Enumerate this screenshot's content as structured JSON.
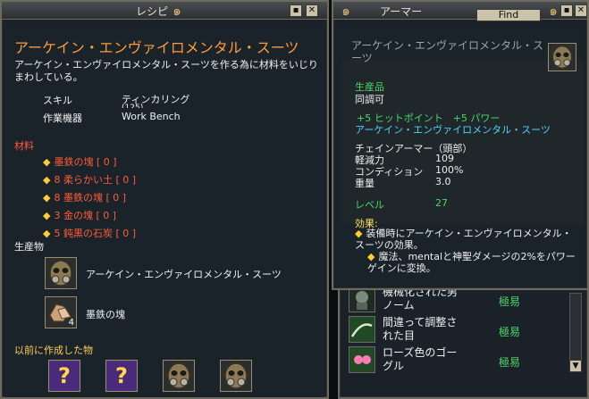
{
  "recipe_window": {
    "title": "レシピ",
    "item_title": "アーケイン・エンヴァイロメンタル・スーツ",
    "description": "アーケイン・エンヴァイロメンタル・スーツを作る為に材料をいじりまわしている。",
    "skill_label": "スキル",
    "skill_value": "ティンカリング",
    "skill_value_cut": "(125)",
    "station_label": "作業機器",
    "station_value": "Work Bench",
    "materials_label": "材料",
    "materials": [
      "墨鉄の塊 [ 0 ]",
      "8 柔らかい土 [ 0 ]",
      "8 墨鉄の塊 [ 0 ]",
      "3 金の塊 [ 0 ]",
      "5 鈍黒の石炭 [ 0 ]"
    ],
    "products_label": "生産物",
    "products": [
      {
        "name": "アーケイン・エンヴァイロメンタル・スーツ",
        "icon": "mask-icon",
        "qty": ""
      },
      {
        "name": "墨鉄の塊",
        "icon": "ore-icon",
        "qty": "4"
      }
    ],
    "previous_label": "以前に作成した物",
    "previous_icons": [
      "question-icon",
      "question-icon",
      "mask-icon",
      "mask-icon"
    ]
  },
  "armor_window": {
    "title": "アーマー",
    "find_label": "Find",
    "item_name": "アーケイン・エンヴァイロメンタル・スーツ",
    "tag1": "生産品",
    "tag2": "同調可",
    "bonus_stats": "+5 ヒットポイント　+5 パワー",
    "set_name": "アーケイン・エンヴァイロメンタル・スーツ",
    "slot": "チェインアーマー（頭部）",
    "stats": [
      {
        "label": "軽減力",
        "value": "109"
      },
      {
        "label": "コンディション",
        "value": "100%"
      },
      {
        "label": "重量",
        "value": "3.0"
      }
    ],
    "level_label": "レベル",
    "level_value": "27",
    "effects_label": "効果:",
    "effect_1": "装備時にアーケイン・エンヴァイロメンタル・スーツの効果。",
    "effect_2": "魔法、mentalと神聖ダメージの2%をパワーゲインに変換。"
  },
  "list_window": {
    "rows": [
      {
        "name": "機械化された男ノーム",
        "difficulty": "極易",
        "icon": "gnome-icon"
      },
      {
        "name": "間違って調整された目",
        "difficulty": "極易",
        "icon": "eye-icon"
      },
      {
        "name": "ローズ色のゴーグル",
        "difficulty": "極易",
        "icon": "goggles-icon"
      }
    ]
  },
  "colors": {
    "title_orange": "#ff9a3a",
    "material_red": "#ff5c3a",
    "stat_green": "#4ed66a",
    "bonus_cyan": "#4fd4ff"
  }
}
